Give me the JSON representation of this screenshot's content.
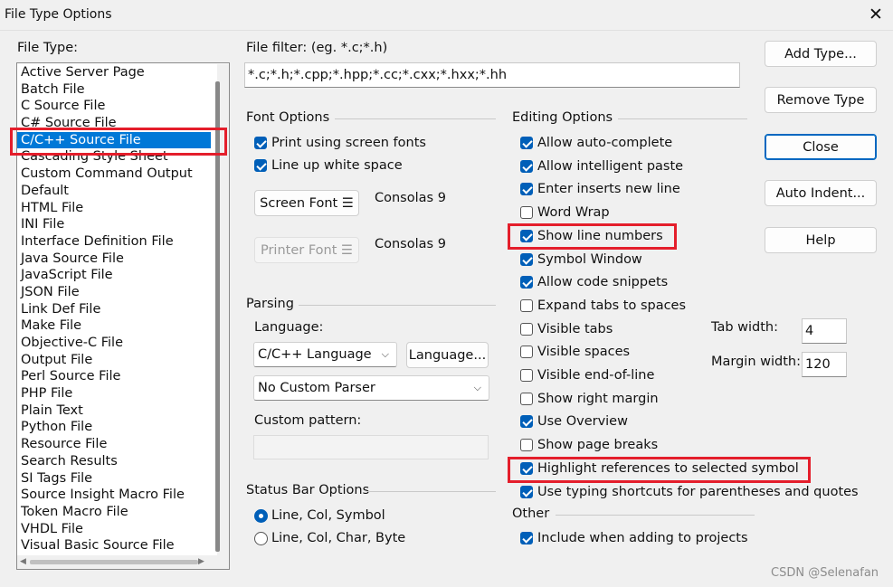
{
  "window": {
    "title": "File Type Options",
    "close_glyph": "✕"
  },
  "file_type": {
    "label": "File Type:",
    "items": [
      "Active Server Page",
      "Batch File",
      "C Source File",
      "C# Source File",
      "C/C++ Source File",
      "Cascading Style Sheet",
      "Custom Command Output",
      "Default",
      "HTML File",
      "INI File",
      "Interface Definition File",
      "Java Source File",
      "JavaScript File",
      "JSON File",
      "Link Def File",
      "Make File",
      "Objective-C File",
      "Output File",
      "Perl Source File",
      "PHP File",
      "Plain Text",
      "Python File",
      "Resource File",
      "Search Results",
      "SI Tags File",
      "Source Insight Macro File",
      "Token Macro File",
      "VHDL File",
      "Visual Basic Source File"
    ],
    "selected_index": 4
  },
  "file_filter": {
    "label": "File filter: (eg. *.c;*.h)",
    "value": "*.c;*.h;*.cpp;*.hpp;*.cc;*.cxx;*.hxx;*.hh"
  },
  "buttons": {
    "add_type": "Add Type...",
    "remove_type": "Remove Type",
    "close": "Close",
    "auto_indent": "Auto Indent...",
    "help": "Help"
  },
  "font_options": {
    "title": "Font Options",
    "print_screen_fonts": {
      "label": "Print using screen fonts",
      "checked": true
    },
    "line_up_white_space": {
      "label": "Line up white space",
      "checked": true
    },
    "screen_font_button": "Screen Font",
    "screen_font_value": "Consolas 9",
    "printer_font_button": "Printer Font",
    "printer_font_value": "Consolas 9",
    "menu_glyph": "☰"
  },
  "parsing": {
    "title": "Parsing",
    "language_label": "Language:",
    "language_value": "C/C++ Language",
    "language_button": "Language...",
    "parser_value": "No Custom Parser",
    "custom_pattern_label": "Custom pattern:",
    "custom_pattern_value": "",
    "chevron": "⌵"
  },
  "status_bar": {
    "title": "Status Bar Options",
    "options": [
      {
        "label": "Line, Col, Symbol",
        "selected": true
      },
      {
        "label": "Line, Col, Char, Byte",
        "selected": false
      }
    ]
  },
  "editing": {
    "title": "Editing Options",
    "options": [
      {
        "label": "Allow auto-complete",
        "checked": true
      },
      {
        "label": "Allow intelligent paste",
        "checked": true
      },
      {
        "label": "Enter inserts new line",
        "checked": true
      },
      {
        "label": "Word Wrap",
        "checked": false
      },
      {
        "label": "Show line numbers",
        "checked": true
      },
      {
        "label": "Symbol Window",
        "checked": true
      },
      {
        "label": "Allow code snippets",
        "checked": true
      },
      {
        "label": "Expand tabs to spaces",
        "checked": false
      },
      {
        "label": "Visible tabs",
        "checked": false
      },
      {
        "label": "Visible spaces",
        "checked": false
      },
      {
        "label": "Visible end-of-line",
        "checked": false
      },
      {
        "label": "Show right margin",
        "checked": false
      },
      {
        "label": "Use Overview",
        "checked": true
      },
      {
        "label": "Show page breaks",
        "checked": false
      },
      {
        "label": "Highlight references to selected symbol",
        "checked": true
      },
      {
        "label": "Use typing shortcuts for parentheses and quotes",
        "checked": true
      }
    ],
    "tab_width_label": "Tab width:",
    "tab_width_value": "4",
    "margin_width_label": "Margin width:",
    "margin_width_value": "120"
  },
  "other": {
    "title": "Other",
    "include_projects": {
      "label": "Include when adding to projects",
      "checked": true
    }
  },
  "watermark": "CSDN @Selenafan",
  "colors": {
    "accent": "#005fb8",
    "selection": "#0078d7",
    "highlight_box": "#e41e2b"
  }
}
